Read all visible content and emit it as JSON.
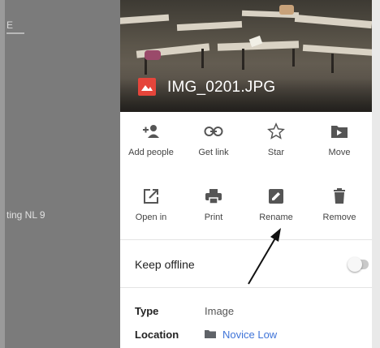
{
  "background": {
    "glyph": "E",
    "row_text": "ting NL 9"
  },
  "file": {
    "name": "IMG_0201.JPG",
    "icon": "image-file-icon"
  },
  "actions": [
    {
      "label": "Add people",
      "icon": "add-person-icon"
    },
    {
      "label": "Get link",
      "icon": "link-icon"
    },
    {
      "label": "Star",
      "icon": "star-icon"
    },
    {
      "label": "Move",
      "icon": "move-folder-icon"
    },
    {
      "label": "Open in",
      "icon": "open-in-icon"
    },
    {
      "label": "Print",
      "icon": "print-icon"
    },
    {
      "label": "Rename",
      "icon": "rename-icon"
    },
    {
      "label": "Remove",
      "icon": "trash-icon"
    }
  ],
  "offline": {
    "label": "Keep offline",
    "enabled": false
  },
  "info": {
    "type_label": "Type",
    "type_value": "Image",
    "location_label": "Location",
    "location_value": "Novice Low"
  },
  "colors": {
    "file_icon": "#e5453b",
    "link": "#3f74d8"
  }
}
